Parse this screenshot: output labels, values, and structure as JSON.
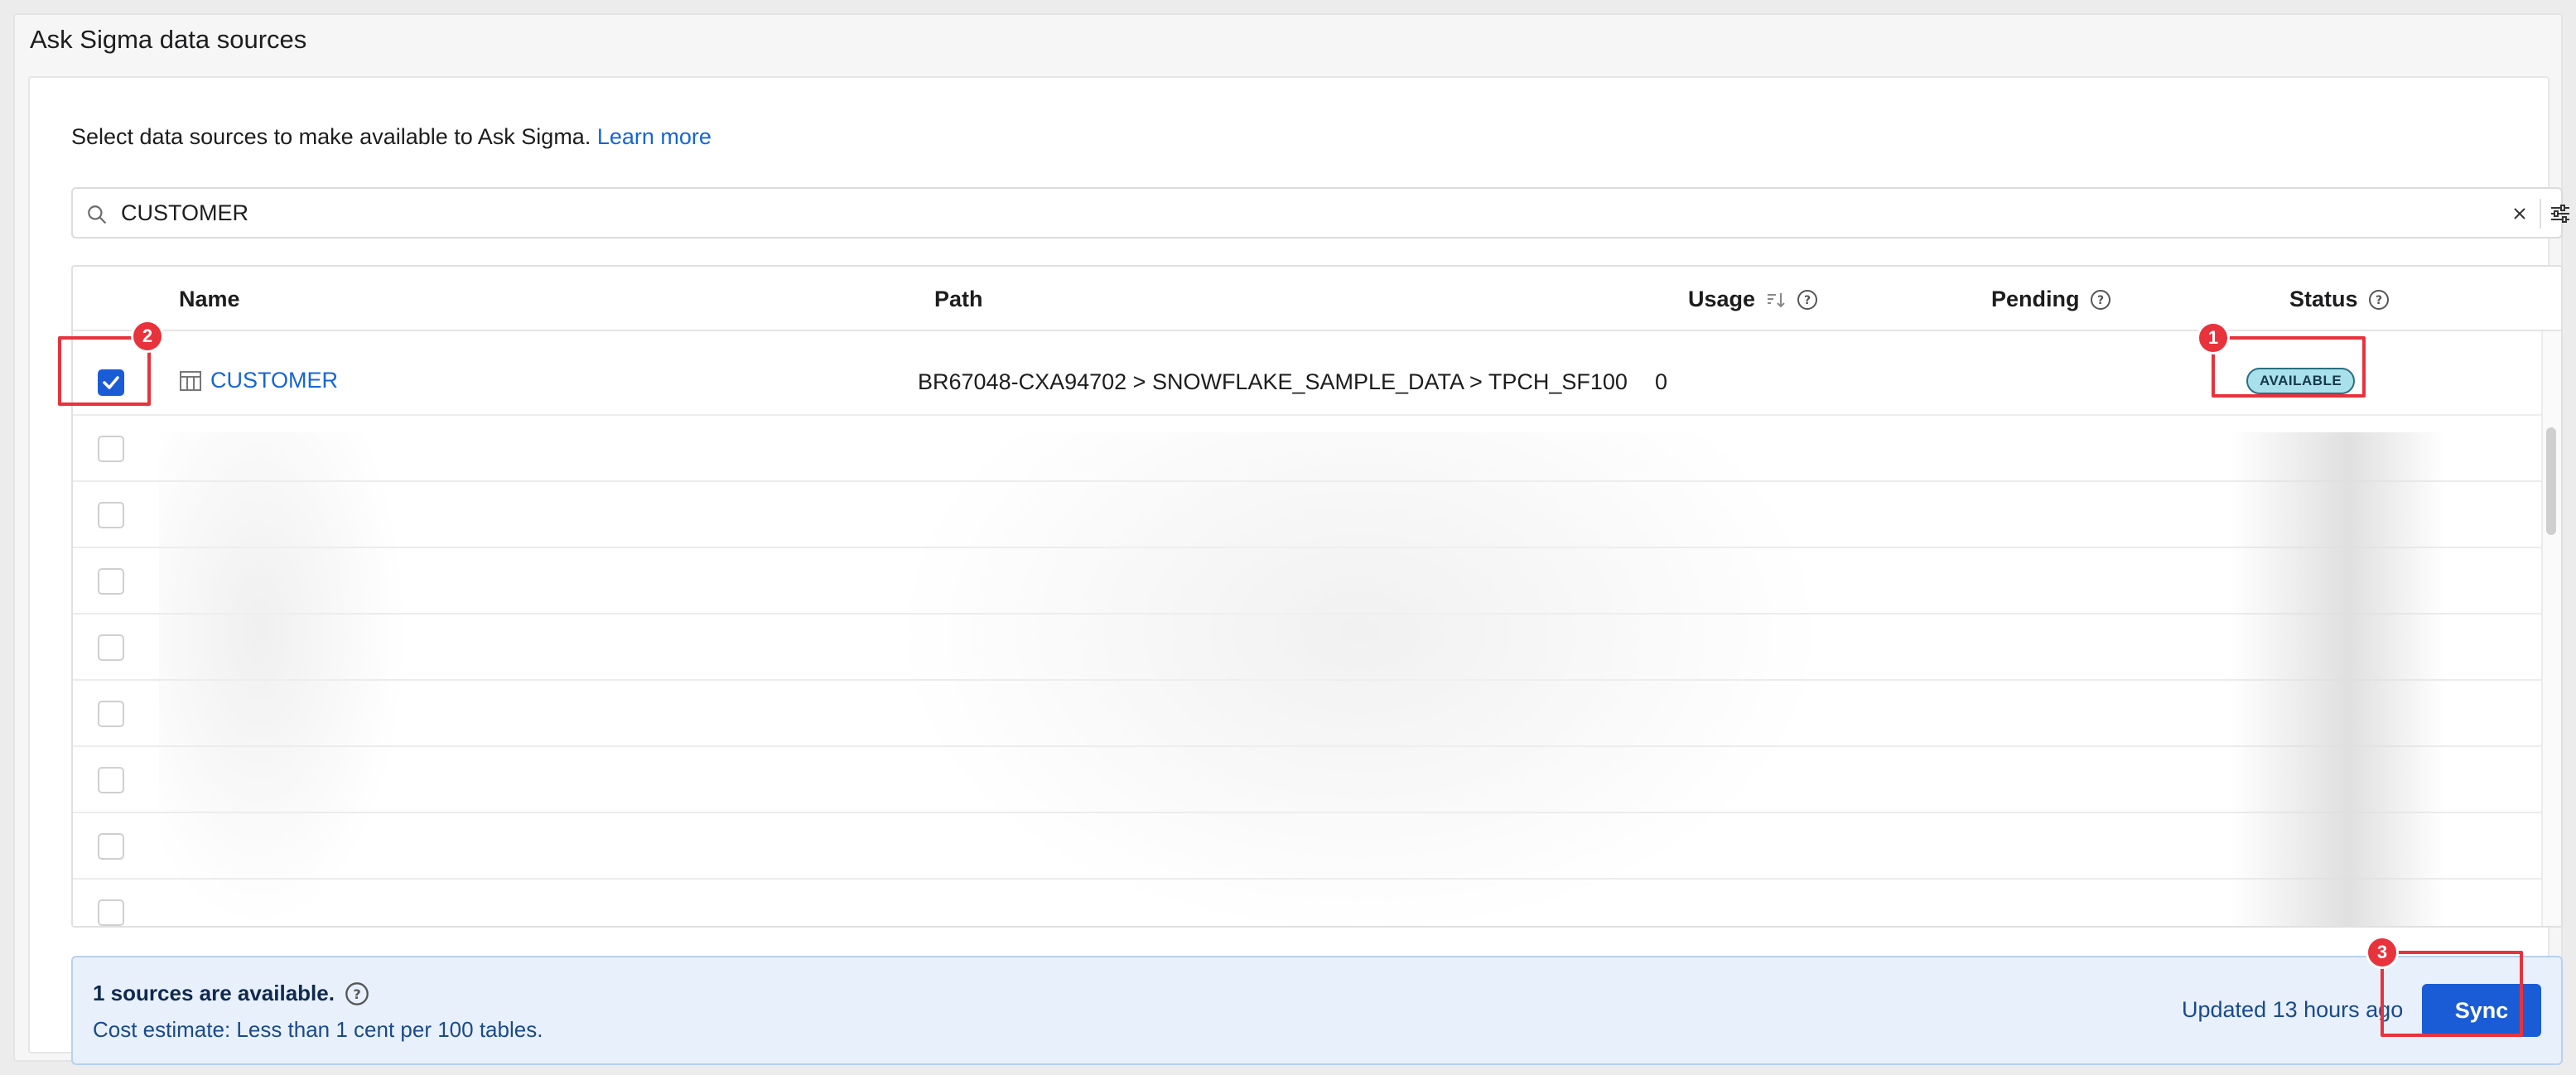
{
  "page": {
    "title": "Ask Sigma data sources"
  },
  "intro": {
    "text": "Select data sources to make available to Ask Sigma.",
    "link": "Learn more"
  },
  "search": {
    "value": "CUSTOMER",
    "icon": "search-icon",
    "clear_icon": "close-icon",
    "filter_icon": "sliders-icon"
  },
  "table": {
    "columns": {
      "name": "Name",
      "path": "Path",
      "usage": "Usage",
      "pending": "Pending",
      "status": "Status"
    },
    "rows": [
      {
        "checked": true,
        "name": "CUSTOMER",
        "path": "BR67048-CXA94702 > SNOWFLAKE_SAMPLE_DATA > TPCH_SF100",
        "usage": "0",
        "pending": "",
        "status": "AVAILABLE"
      }
    ],
    "blurred_rows": 8
  },
  "footer": {
    "available": "1 sources are available.",
    "cost": "Cost estimate: Less than 1 cent per 100 tables.",
    "updated": "Updated 13 hours ago",
    "sync_label": "Sync"
  },
  "annotations": {
    "marker_1": "1",
    "marker_2": "2",
    "marker_3": "3"
  },
  "colors": {
    "accent": "#1a5cd6",
    "link": "#1565d8",
    "badge_bg": "#a8e1ec",
    "highlight": "#e8323c",
    "footer_bg": "#e8f0fb"
  }
}
